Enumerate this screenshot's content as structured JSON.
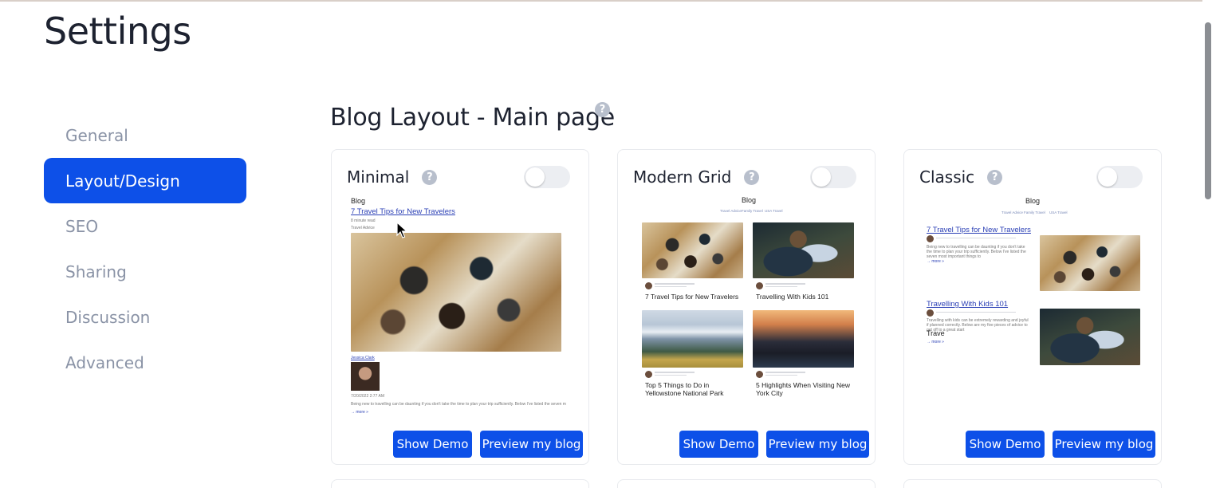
{
  "page": {
    "title": "Settings"
  },
  "sidebar": {
    "items": [
      {
        "label": "General",
        "active": false
      },
      {
        "label": "Layout/Design",
        "active": true
      },
      {
        "label": "SEO",
        "active": false
      },
      {
        "label": "Sharing",
        "active": false
      },
      {
        "label": "Discussion",
        "active": false
      },
      {
        "label": "Advanced",
        "active": false
      }
    ]
  },
  "section": {
    "title": "Blog Layout - Main page",
    "help_icon": "question-circle-icon"
  },
  "cards": [
    {
      "title": "Minimal",
      "enabled": false,
      "show_demo_label": "Show Demo",
      "preview_label": "Preview my blog",
      "preview": {
        "blog_label": "Blog",
        "post_title": "7 Travel Tips for New Travelers",
        "read_time": "8 minute read",
        "category": "Travel Advice",
        "author": "Jessica Clark",
        "date": "7/20/2022 2:77 AM",
        "excerpt": "Being new to travelling can be daunting if you don't take the time to plan your trip sufficiently. Below I've listed the seven most important things to",
        "more": "→ more »"
      }
    },
    {
      "title": "Modern Grid",
      "enabled": false,
      "show_demo_label": "Show Demo",
      "preview_label": "Preview my blog",
      "preview": {
        "blog_label": "Blog",
        "tabs": [
          "Travel Advice",
          "Family Travel",
          "USA Travel"
        ],
        "posts": [
          {
            "title": "7 Travel Tips for New Travelers"
          },
          {
            "title": "Travelling With Kids 101"
          },
          {
            "title": "Top 5 Things to Do in Yellowstone National Park"
          },
          {
            "title": "5 Highlights When Visiting New York City"
          }
        ]
      }
    },
    {
      "title": "Classic",
      "enabled": false,
      "show_demo_label": "Show Demo",
      "preview_label": "Preview my blog",
      "preview": {
        "blog_label": "Blog",
        "tabs": [
          "Travel Advice",
          "Family Travel",
          "USA Travel"
        ],
        "post1_title": "7 Travel Tips for New Travelers",
        "post1_excerpt": "Being new to travelling can be daunting if you don't take the time to plan your trip sufficiently. Below I've listed the seven most important things to",
        "post2_title": "Travelling With Kids 101",
        "post2_excerpt": "Travelling with kids can be extremely rewarding and joyful if planned correctly. Below are my five pieces of advice to get off to a great start",
        "post2_extra": "Trave",
        "more": "→ more »"
      }
    }
  ]
}
